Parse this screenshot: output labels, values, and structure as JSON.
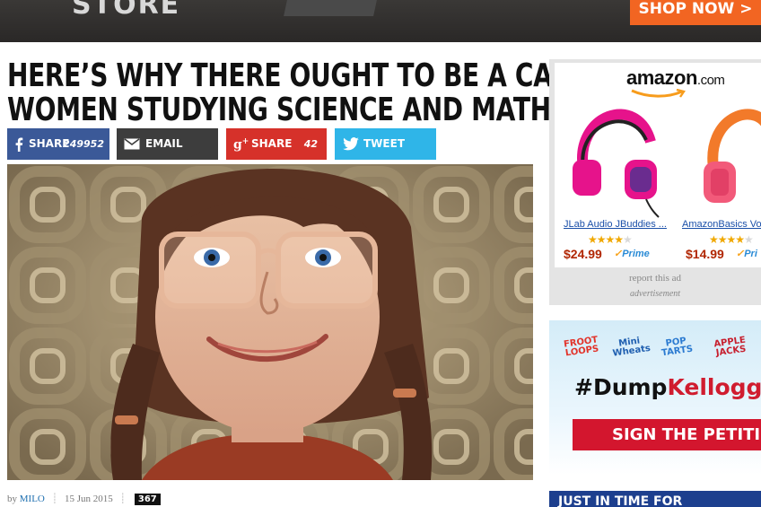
{
  "banner": {
    "logo_text": "STORE",
    "cta": "SHOP NOW >"
  },
  "article": {
    "headline_line1": "HERE’S WHY THERE OUGHT TO BE A CAP ON",
    "headline_line2": "WOMEN STUDYING SCIENCE AND MATHS",
    "share": {
      "facebook_label": "SHARE",
      "facebook_count": "249952",
      "email_label": "EMAIL",
      "gplus_label": "SHARE",
      "gplus_count": "42",
      "twitter_label": "TWEET"
    },
    "byline": {
      "by": "by",
      "author": "MILO",
      "date": "15 Jun 2015",
      "comment_count": "367"
    }
  },
  "sidebar": {
    "amazon_ad": {
      "logo": "amazon",
      "logo_suffix": ".com",
      "products": [
        {
          "name": "JLab Audio JBuddies ...",
          "price": "$24.99",
          "stars": 4,
          "prime": "Prime"
        },
        {
          "name": "AmazonBasics Vol",
          "price": "$14.99",
          "stars": 4,
          "prime": "Pri"
        }
      ],
      "report": "report this ad",
      "label": "advertisement"
    },
    "kellogg_ad": {
      "cereals": [
        "FROOT LOOPS",
        "Mini Wheats",
        "POP TARTS",
        "APPLE JACKS"
      ],
      "hashtag_prefix": "#Dump",
      "hashtag_brand": "Kellogg",
      "cta": "SIGN THE PETITION"
    },
    "bottom_ad": {
      "text": "JUST IN TIME FOR"
    }
  },
  "colors": {
    "facebook": "#3b5998",
    "email": "#3d3d3d",
    "gplus": "#d6312a",
    "twitter": "#2fb5e8",
    "shop_now": "#f26522",
    "petition": "#d3162e"
  }
}
